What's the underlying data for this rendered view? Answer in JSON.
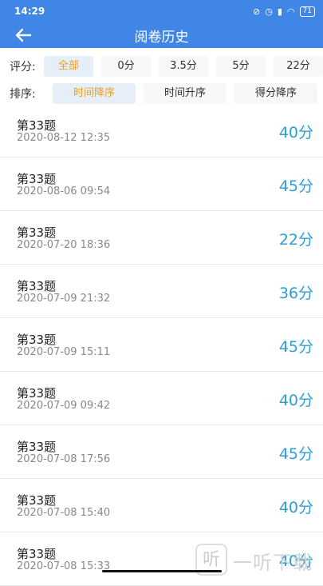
{
  "status": {
    "time": "14:29",
    "battery": "71"
  },
  "header": {
    "title": "阅卷历史"
  },
  "filters": {
    "score_label": "评分:",
    "score_options": [
      "全部",
      "0分",
      "3.5分",
      "5分",
      "22分"
    ],
    "score_selected": 0,
    "sort_label": "排序:",
    "sort_options": [
      "时间降序",
      "时间升序",
      "得分降序"
    ],
    "sort_selected": 0
  },
  "records": [
    {
      "title": "第33题",
      "time": "2020-08-12 12:35",
      "score": "40分"
    },
    {
      "title": "第33题",
      "time": "2020-08-06 09:54",
      "score": "45分"
    },
    {
      "title": "第33题",
      "time": "2020-07-20 18:36",
      "score": "22分"
    },
    {
      "title": "第33题",
      "time": "2020-07-09 21:32",
      "score": "36分"
    },
    {
      "title": "第33题",
      "time": "2020-07-09 15:11",
      "score": "45分"
    },
    {
      "title": "第33题",
      "time": "2020-07-09 09:42",
      "score": "40分"
    },
    {
      "title": "第33题",
      "time": "2020-07-08 17:56",
      "score": "45分"
    },
    {
      "title": "第33题",
      "time": "2020-07-08 15:40",
      "score": "40分"
    },
    {
      "title": "第33题",
      "time": "2020-07-08 15:33",
      "score": "40分"
    }
  ],
  "watermark": {
    "logo": "听",
    "text": "一听下载"
  },
  "colors": {
    "header": "#3f86e6",
    "accent": "#f0a020",
    "score": "#2a9fd6"
  }
}
